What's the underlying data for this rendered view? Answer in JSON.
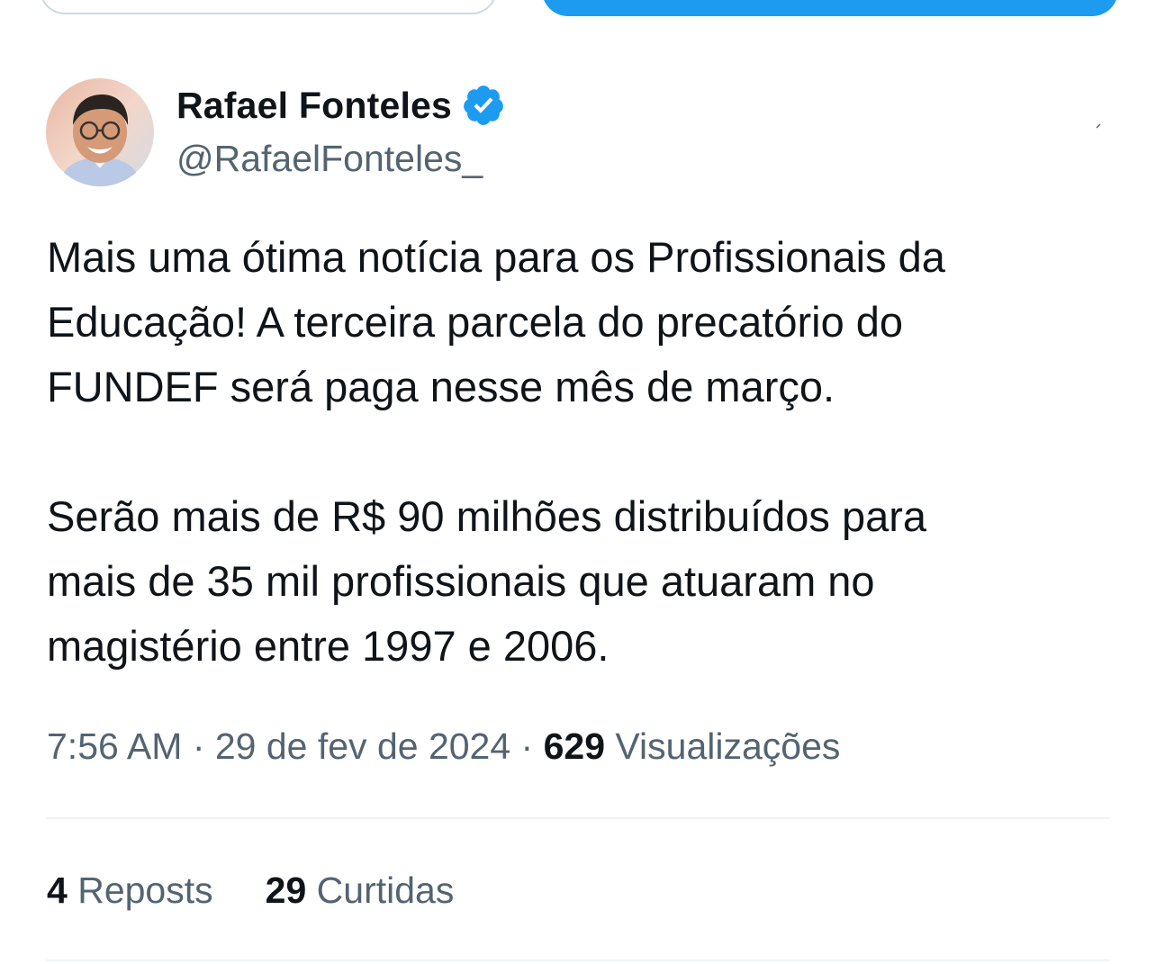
{
  "author": {
    "display_name": "Rafael Fonteles",
    "handle": "@RafaelFonteles_",
    "verified_icon": "verified-badge-icon",
    "avatar": "profile-photo"
  },
  "tweet": {
    "paragraphs": [
      {
        "lines": [
          "Mais uma ótima notícia para os Profissionais da",
          "Educação! A terceira parcela do precatório do",
          "FUNDEF será paga nesse mês de março."
        ]
      },
      {
        "lines": [
          "Serão mais de R$ 90 milhões distribuídos para",
          "mais de 35 mil profissionais que atuaram no",
          "magistério entre 1997 e 2006."
        ]
      }
    ]
  },
  "meta": {
    "time": "7:56 AM",
    "separator": " · ",
    "date": "29 de fev de 2024",
    "views_count": "629",
    "views_label": "Visualizações"
  },
  "stats": {
    "reposts_count": "4",
    "reposts_label": "Reposts",
    "likes_count": "29",
    "likes_label": "Curtidas"
  },
  "colors": {
    "primary_text": "#0f1419",
    "secondary_text": "#536471",
    "accent": "#1d9bf0",
    "divider": "#eff3f4"
  }
}
